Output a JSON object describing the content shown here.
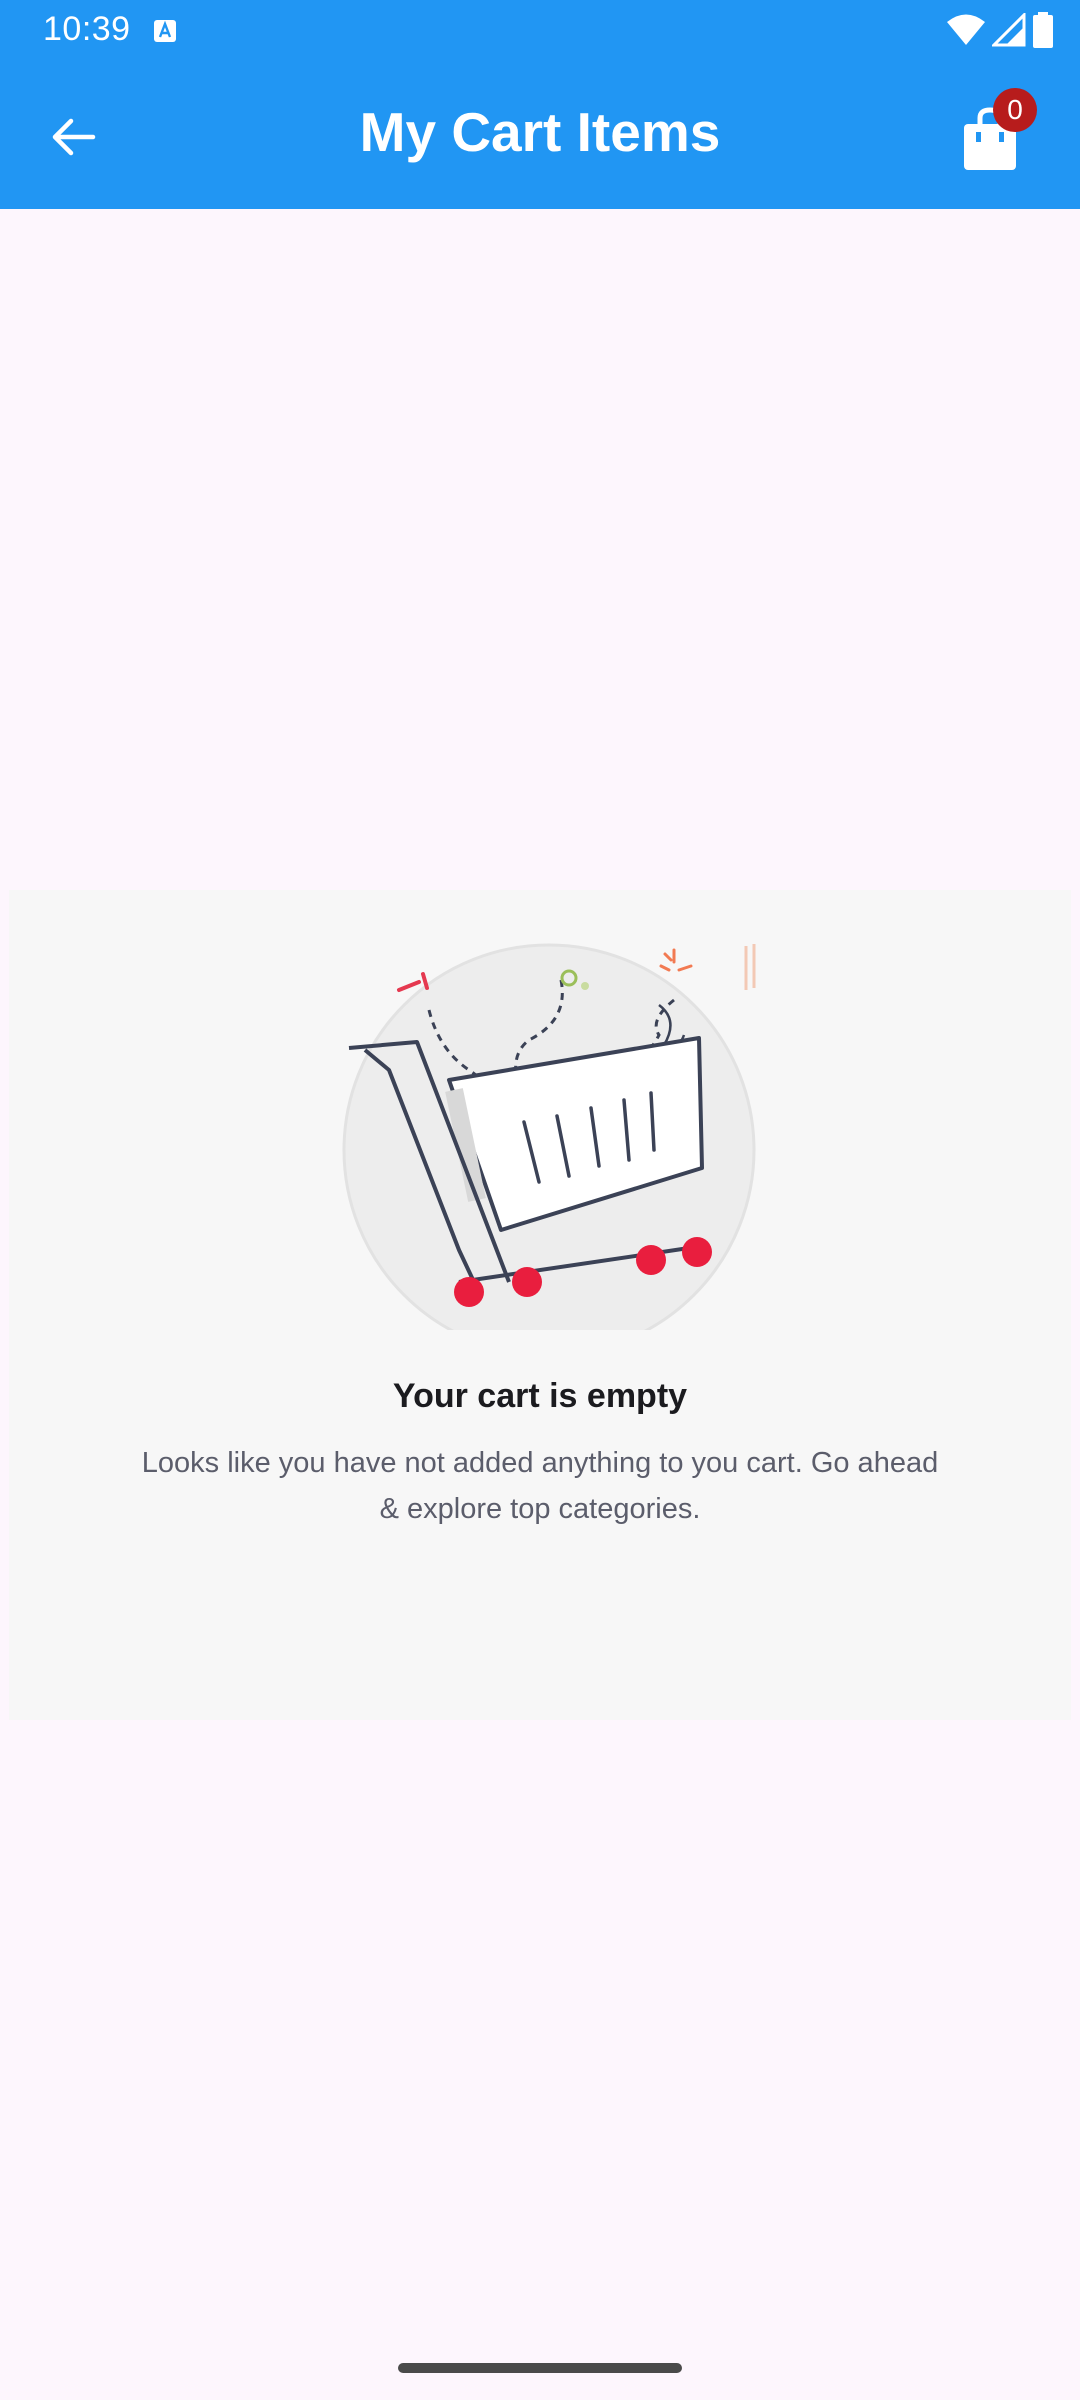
{
  "status_bar": {
    "time": "10:39",
    "icons": [
      "accessibility-a-icon",
      "wifi-icon",
      "signal-icon",
      "battery-icon"
    ]
  },
  "app_bar": {
    "title": "My Cart Items",
    "back_icon": "arrow-left-icon",
    "cart_icon": "shopping-bag-icon",
    "cart_count": "0",
    "background_color": "#2196f3",
    "badge_color": "#b71c1c"
  },
  "empty_state": {
    "illustration": "empty-shopping-cart-illustration",
    "title": "Your cart is empty",
    "message": "Looks like you have not added anything to you cart. Go ahead & explore top categories."
  }
}
